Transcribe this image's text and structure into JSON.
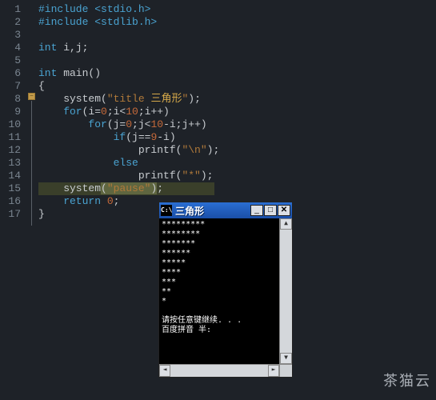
{
  "gutter": {
    "lines": [
      "1",
      "2",
      "3",
      "4",
      "5",
      "6",
      "7",
      "8",
      "9",
      "10",
      "11",
      "12",
      "13",
      "14",
      "15",
      "16",
      "17"
    ]
  },
  "code": {
    "l1_pre": "#include ",
    "l1_hdr": "<stdio.h>",
    "l2_pre": "#include ",
    "l2_hdr": "<stdlib.h>",
    "l4_a": "int",
    "l4_b": " i,j;",
    "l6_a": "int",
    "l6_b": " main",
    "l6_c": "()",
    "l7": "{",
    "l8_a": "    system(",
    "l8_b": "\"title ",
    "l8_c": "三角形",
    "l8_d": "\"",
    "l8_e": ");",
    "l9_a": "    for",
    "l9_b": "(i=",
    "l9_c": "0",
    "l9_d": ";i<",
    "l9_e": "10",
    "l9_f": ";i++)",
    "l10_a": "        for",
    "l10_b": "(j=",
    "l10_c": "0",
    "l10_d": ";j<",
    "l10_e": "10",
    "l10_f": "-i;j++)",
    "l11_a": "            if",
    "l11_b": "(j==",
    "l11_c": "9",
    "l11_d": "-i)",
    "l12_a": "                printf(",
    "l12_b": "\"\\n\"",
    "l12_c": ");",
    "l13_a": "            else",
    "l14_a": "                printf(",
    "l14_b": "\"*\"",
    "l14_c": ");",
    "l15_a": "    system",
    "l15_b": "(",
    "l15_c": "\"pause\"",
    "l15_d": ")",
    "l15_e": ";",
    "l16_a": "    return ",
    "l16_b": "0",
    "l16_c": ";",
    "l17": "}"
  },
  "fold": {
    "glyph": "−"
  },
  "console": {
    "icon_text": "C:\\",
    "title": "三角形",
    "btn_min": "_",
    "btn_max": "□",
    "btn_close": "✕",
    "output": "*********\n********\n*******\n******\n*****\n****\n***\n**\n*\n\n请按任意键继续. . .\n百度拼音 半:",
    "scroll_up": "▲",
    "scroll_down": "▼",
    "scroll_left": "◄",
    "scroll_right": "►"
  },
  "watermark": "茶猫云"
}
